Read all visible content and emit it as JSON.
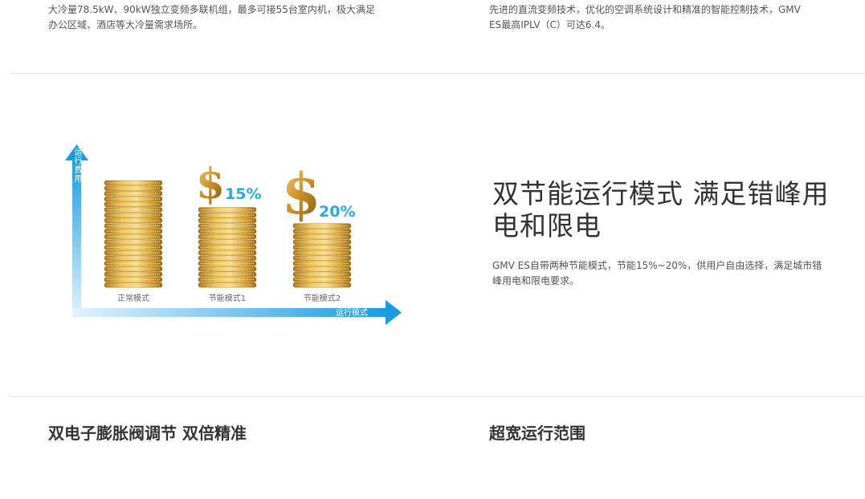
{
  "top_left": {
    "line1": "大冷量78.5kW、90kW独立变频多联机组，最多可接55台室内机，极大满足",
    "line2": "办公区域、酒店等大冷量需求场所。"
  },
  "top_right": {
    "line1": "先进的直流变频技术，优化的空调系统设计和精准的智能控制技术，GMV",
    "line2": "ES最高IPLV（C）可达6.4。"
  },
  "feature": {
    "title_line1": "双节能运行模式 满足错峰用",
    "title_line2": "电和限电",
    "desc_line1": "GMV ES自带两种节能模式，节能15%~20%，供用户自由选择，满足城市错",
    "desc_line2": "峰用电和限电要求。"
  },
  "infographic": {
    "y_axis_label": "运行费用",
    "x_axis_label": "运行模式",
    "stacks": [
      {
        "label": "正常模式",
        "coins": 20,
        "saving": ""
      },
      {
        "label": "节能模式1",
        "coins": 15,
        "saving": "15%"
      },
      {
        "label": "节能模式2",
        "coins": 12,
        "saving": "20%"
      }
    ],
    "colors": {
      "arrow": "#1a9be0",
      "percent": "#2aa8e2",
      "coin": "#d9a63a"
    }
  },
  "bottom": {
    "left_heading": "双电子膨胀阀调节 双倍精准",
    "right_heading": "超宽运行范围"
  }
}
